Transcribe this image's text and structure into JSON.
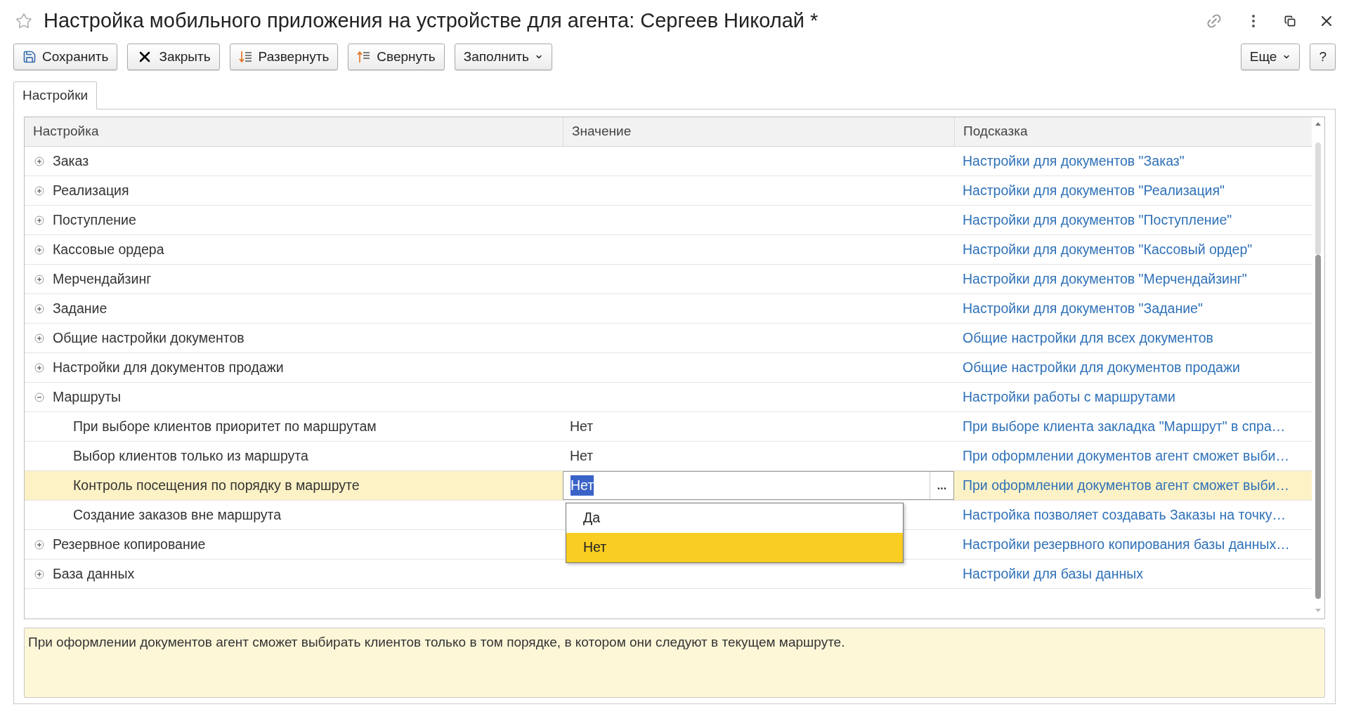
{
  "window": {
    "title": "Настройка мобильного приложения на устройстве для агента: Сергеев Николай *"
  },
  "toolbar": {
    "left": [
      {
        "kind": "save",
        "label": "Сохранить"
      },
      {
        "kind": "close",
        "label": "Закрыть"
      },
      {
        "kind": "expand",
        "label": "Развернуть"
      },
      {
        "kind": "collapse",
        "label": "Свернуть"
      },
      {
        "kind": "menu",
        "label": "Заполнить"
      }
    ],
    "right": [
      {
        "kind": "menu",
        "label": "Еще"
      },
      {
        "kind": "plain",
        "label": "?"
      }
    ]
  },
  "tabs": [
    {
      "label": "Настройки",
      "selected": true
    }
  ],
  "table": {
    "columns": [
      "Настройка",
      "Значение",
      "Подсказка"
    ],
    "rows": [
      {
        "setting": "Заказ",
        "hint": "Настройки для документов \"Заказ\"",
        "expanded": false,
        "selected": false
      },
      {
        "setting": "Реализация",
        "hint": "Настройки для документов \"Реализация\"",
        "expanded": false,
        "selected": false
      },
      {
        "setting": "Поступление",
        "hint": "Настройки для документов \"Поступление\"",
        "expanded": false,
        "selected": false
      },
      {
        "setting": "Кассовые ордера",
        "hint": "Настройки для документов \"Кассовый ордер\"",
        "expanded": false,
        "selected": false
      },
      {
        "setting": "Мерчендайзинг",
        "hint": "Настройки для документов \"Мерчендайзинг\"",
        "expanded": false,
        "selected": false
      },
      {
        "setting": "Задание",
        "hint": "Настройки для документов \"Задание\"",
        "expanded": false,
        "selected": false
      },
      {
        "setting": "Общие настройки документов",
        "hint": "Общие настройки для всех документов",
        "expanded": false,
        "selected": false
      },
      {
        "setting": "Настройки для документов продажи",
        "hint": "Общие настройки для документов продажи",
        "expanded": false,
        "selected": false
      },
      {
        "setting": "Маршруты",
        "hint": "Настройки работы с маршрутами",
        "expanded": true,
        "selected": false,
        "children": [
          {
            "setting": "При выборе клиентов приоритет по маршрутам",
            "value": "Нет",
            "hint": "При выборе клиента закладка \"Маршрут\" в спра…",
            "selected": false
          },
          {
            "setting": "Выбор клиентов только из маршрута",
            "value": "Нет",
            "hint": "При оформлении документов агент сможет выби…",
            "selected": false
          },
          {
            "setting": "Контроль посещения по порядку в маршруте",
            "value": "Нет",
            "hint": "При оформлении документов агент сможет выби…",
            "selected": true,
            "editing": true,
            "edit_button": "...",
            "options": [
              {
                "label": "Да",
                "selected": false
              },
              {
                "label": "Нет",
                "selected": true
              }
            ]
          },
          {
            "setting": "Создание заказов вне маршрута",
            "hint": "Настройка позволяет создавать Заказы на точку…",
            "selected": false
          }
        ]
      },
      {
        "setting": "Резервное копирование",
        "hint": "Настройки резервного копирования базы данных…",
        "expanded": false,
        "selected": false
      },
      {
        "setting": "База данных",
        "hint": "Настройки для базы данных",
        "expanded": false,
        "selected": false
      }
    ]
  },
  "description": "При оформлении документов агент сможет выбирать клиентов только в том порядке, в котором они следуют в текущем маршруте."
}
